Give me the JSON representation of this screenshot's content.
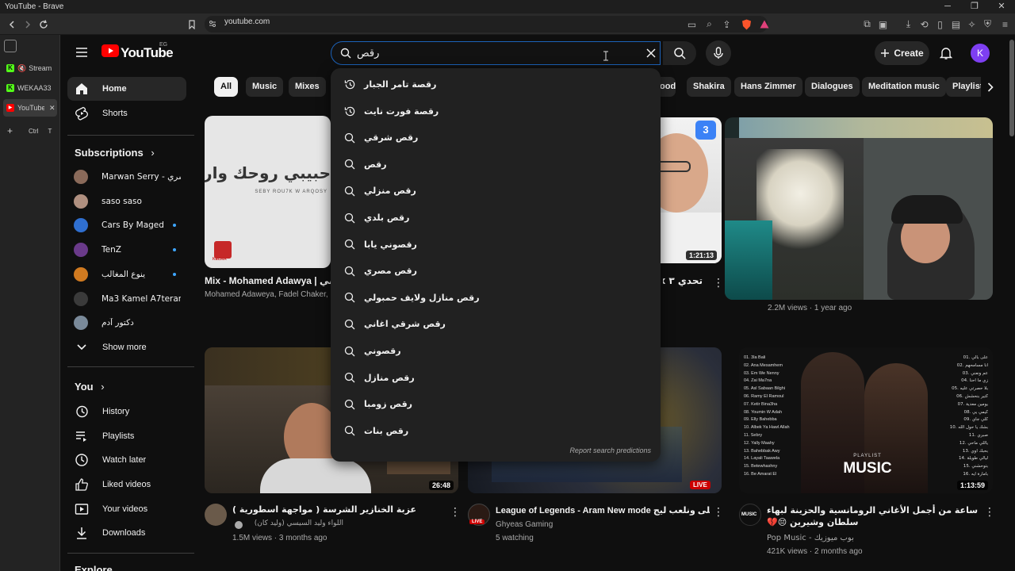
{
  "browser": {
    "window_title": "YouTube - Brave",
    "url": "youtube.com",
    "tabs": [
      {
        "label": "Stream",
        "color": "#53fc18",
        "glyph": "K"
      },
      {
        "label": "WEKAA33",
        "color": "#53fc18",
        "glyph": "K"
      },
      {
        "label": "YouTube",
        "color": "#ff0000",
        "glyph": "▶",
        "close": "✕"
      }
    ],
    "new_tab_label": "Ctrl T",
    "new_tab_glyph": "+"
  },
  "header": {
    "logo_text": "YouTube",
    "country_code": "EG",
    "search_value": "رقص",
    "create_label": "Create",
    "avatar_letter": "K"
  },
  "sidebar": {
    "main": [
      {
        "label": "Home",
        "icon": "home-icon"
      },
      {
        "label": "Shorts",
        "icon": "shorts-icon"
      }
    ],
    "subscriptions_title": "Subscriptions",
    "subscriptions": [
      {
        "name": "Marwan Serry - مروان سري",
        "color": "#8a6a5a",
        "dot": false
      },
      {
        "name": "saso saso",
        "color": "#b09080",
        "dot": false
      },
      {
        "name": "Cars By Maged",
        "color": "#2f6fd0",
        "dot": true
      },
      {
        "name": "TenZ",
        "color": "#6a3a8a",
        "dot": true
      },
      {
        "name": "ينوع المغالب",
        "color": "#d07a20",
        "dot": true
      },
      {
        "name": "Ma3 Kamel A7terami",
        "color": "#3a3a3a",
        "dot": false
      },
      {
        "name": "دكتور آدم",
        "color": "#7a8a9a",
        "dot": false
      }
    ],
    "show_more": "Show more",
    "you_title": "You",
    "you": [
      {
        "label": "History",
        "icon": "history-icon"
      },
      {
        "label": "Playlists",
        "icon": "playlists-icon"
      },
      {
        "label": "Watch later",
        "icon": "watch-later-icon"
      },
      {
        "label": "Liked videos",
        "icon": "like-icon"
      },
      {
        "label": "Your videos",
        "icon": "your-videos-icon"
      },
      {
        "label": "Downloads",
        "icon": "download-icon"
      }
    ],
    "explore_title": "Explore"
  },
  "chips": [
    "All",
    "Music",
    "Mixes",
    "ood",
    "Shakira",
    "Hans Zimmer",
    "Dialogues",
    "Meditation music",
    "Playlists"
  ],
  "suggestions": [
    {
      "text": "رقصة تامر الجبار",
      "type": "history"
    },
    {
      "text": "رقصة فورت نايت",
      "type": "history"
    },
    {
      "text": "رقص شرقي",
      "type": "search"
    },
    {
      "text": "رقص",
      "type": "search"
    },
    {
      "text": "رقص منزلي",
      "type": "search"
    },
    {
      "text": "رقص بلدي",
      "type": "search"
    },
    {
      "text": "رقصوني يابا",
      "type": "search"
    },
    {
      "text": "رقص مصري",
      "type": "search"
    },
    {
      "text": "رقص منازل ولايف حمبولي",
      "type": "search"
    },
    {
      "text": "رقص شرقي اغاني",
      "type": "search"
    },
    {
      "text": "رقصوني",
      "type": "search"
    },
    {
      "text": "رقص منازل",
      "type": "search"
    },
    {
      "text": "رقص زومبا",
      "type": "search"
    },
    {
      "text": "رقص بنات",
      "type": "search"
    }
  ],
  "report_label": "Report search predictions",
  "videos": {
    "v1": {
      "title": "Mix - Mohamed Adawya | حبيبي روحك وارقصي",
      "meta": "Mohamed Adaweya, Fadel Chaker,",
      "thumb_text": "حبيبي روحك وارقصي",
      "thumb_sub": "SEBY ROU7K W ARQOSY",
      "thumb_logo": "KELMA"
    },
    "v2": {
      "duration": "1:21:13",
      "title": "تحدي ٣ x",
      "badge": "3"
    },
    "v3": {
      "meta": "2.2M views · 1 year ago"
    },
    "v4": {
      "title": "عزبة الخنازير الشرسة ( مواجهة اسطورية )",
      "channel": "اللواء وليد السيسي (وليد كان)",
      "meta": "1.5M views · 3 months ago",
      "duration": "26:48"
    },
    "v5": {
      "title": "League of Legends - Aram New mode تسلى ونلعب ليج",
      "channel": "Ghyeas Gaming",
      "meta": "5 watching",
      "live": "LIVE",
      "avatar_live": "LIVE"
    },
    "v6": {
      "title": "ساعة من أجمل الأغاني الرومانسية والحزينة لبهاء سلطان وشيرين 😔💔",
      "channel": "Pop Music - بوب ميوزيك",
      "meta": "421K views · 2 months ago",
      "duration": "1:13:59",
      "thumb_label": "PLAYLIST",
      "thumb_music": "MUSIC",
      "avatar_text": "MUSIC"
    }
  },
  "playlist_tracks_left": [
    "01. 3la Bali",
    "02. Ana Mesamhem",
    "03. Em We Nenny",
    "04. Zai Ma7na",
    "05. Asl Sabaan Bilghi",
    "06. Ramy El Ramoul",
    "07. Ketir Bina3ha",
    "08. Youmin W Adah",
    "09. Elly Bahebba",
    "10. Albek Ya Hawl Allah",
    "11. Sebry",
    "12. Yally Maahy",
    "13. Bahebbak Awy",
    "14. Layali Taawela",
    "15. Betewhashny",
    "16. Be Amarat El"
  ],
  "playlist_tracks_right": [
    "01. على بالي",
    "02. أنا مسامحهم",
    "03. عم ونعني",
    "04. زي ما احنا",
    "05. بلا حصرتي عليه",
    "06. كتير بنحشش",
    "07. يومين معدية",
    "08. كيمي يي",
    "09. كلي جاي",
    "10. بشك يا حول الله",
    "11. صبري",
    "12. ياللي ماحي",
    "13. بحبك اوي",
    "14. ليالي طويلة",
    "15. بتوحشني",
    "16. بأمارة ايه"
  ]
}
